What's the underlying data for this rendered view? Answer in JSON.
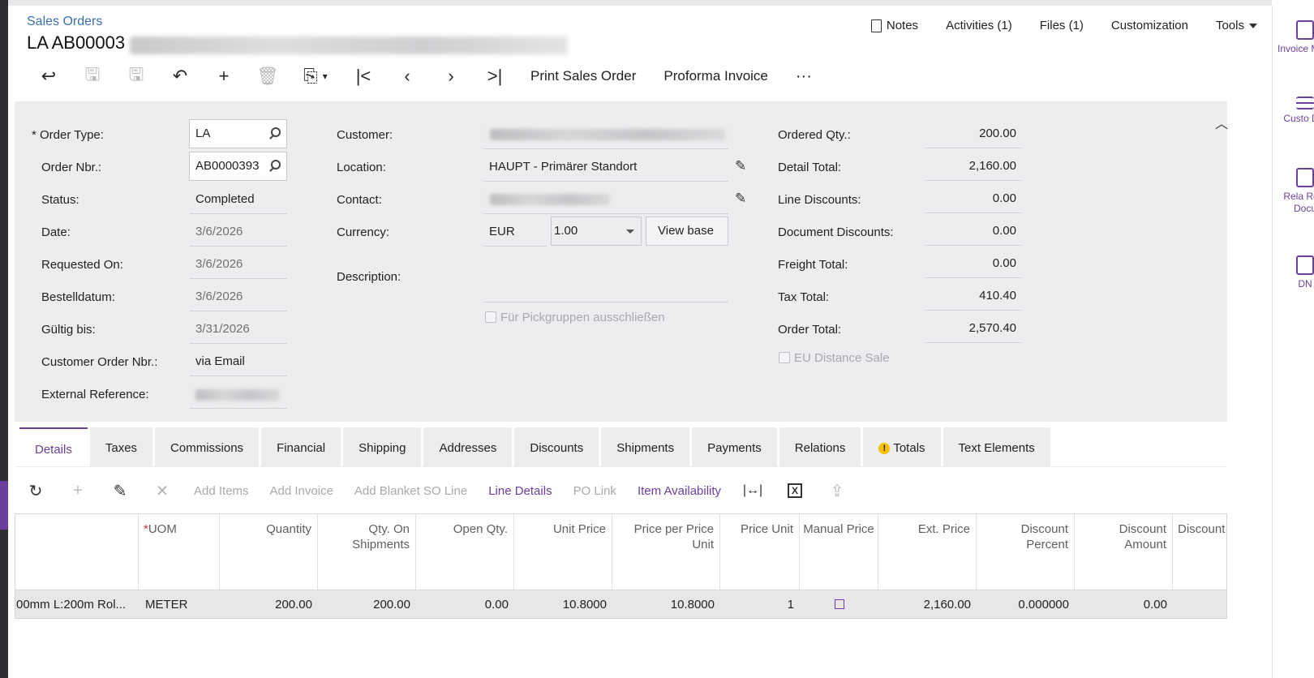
{
  "breadcrumb": "Sales Orders",
  "title": "LA AB00003",
  "top_menu": {
    "notes": "Notes",
    "activities": "Activities (1)",
    "files": "Files (1)",
    "customization": "Customization",
    "tools": "Tools"
  },
  "toolbar": {
    "print": "Print Sales Order",
    "proforma": "Proforma Invoice",
    "more": "···"
  },
  "right_panel": [
    {
      "label": "Invoice Mem",
      "icon": "invoice-icon"
    },
    {
      "label": "Custo Det",
      "icon": "list-icon"
    },
    {
      "label": "Rela Rete Docu",
      "icon": "related-docs-icon"
    },
    {
      "label": "DN",
      "icon": "dn-icon"
    }
  ],
  "form": {
    "order_type": {
      "label": "Order Type:",
      "required": "*",
      "value": "LA"
    },
    "order_nbr": {
      "label": "Order Nbr.:",
      "value": "AB0000393"
    },
    "status": {
      "label": "Status:",
      "value": "Completed"
    },
    "date": {
      "label": "Date:",
      "value": "3/6/2026"
    },
    "requested_on": {
      "label": "Requested On:",
      "value": "3/6/2026"
    },
    "bestelldatum": {
      "label": "Bestelldatum:",
      "value": "3/6/2026"
    },
    "gueltig_bis": {
      "label": "Gültig bis:",
      "value": "3/31/2026"
    },
    "customer_order_nbr": {
      "label": "Customer Order Nbr.:",
      "value": "via Email"
    },
    "external_reference": {
      "label": "External Reference:"
    },
    "customer": {
      "label": "Customer:"
    },
    "location": {
      "label": "Location:",
      "value": "HAUPT - Primärer Standort"
    },
    "contact": {
      "label": "Contact:"
    },
    "currency": {
      "label": "Currency:",
      "value": "EUR",
      "rate": "1.00",
      "view_base": "View base"
    },
    "description": {
      "label": "Description:",
      "value": ""
    },
    "pickgruppen": {
      "label": "Für Pickgruppen ausschließen",
      "checked": false
    },
    "ordered_qty": {
      "label": "Ordered Qty.:",
      "value": "200.00"
    },
    "detail_total": {
      "label": "Detail Total:",
      "value": "2,160.00"
    },
    "line_discounts": {
      "label": "Line Discounts:",
      "value": "0.00"
    },
    "document_discounts": {
      "label": "Document Discounts:",
      "value": "0.00"
    },
    "freight_total": {
      "label": "Freight Total:",
      "value": "0.00"
    },
    "tax_total": {
      "label": "Tax Total:",
      "value": "410.40"
    },
    "order_total": {
      "label": "Order Total:",
      "value": "2,570.40"
    },
    "eu_distance_sale": {
      "label": "EU Distance Sale",
      "checked": false
    }
  },
  "tabs": [
    "Details",
    "Taxes",
    "Commissions",
    "Financial",
    "Shipping",
    "Addresses",
    "Discounts",
    "Shipments",
    "Payments",
    "Relations",
    "Totals",
    "Text Elements"
  ],
  "active_tab": "Details",
  "grid_toolbar": {
    "add_items": "Add Items",
    "add_invoice": "Add Invoice",
    "add_blanket": "Add Blanket SO Line",
    "line_details": "Line Details",
    "po_link": "PO Link",
    "item_availability": "Item Availability"
  },
  "grid": {
    "columns": [
      "",
      "UOM",
      "Quantity",
      "Qty. On Shipments",
      "Open Qty.",
      "Unit Price",
      "Price per Price Unit",
      "Price Unit",
      "Manual Price",
      "Ext. Price",
      "Discount Percent",
      "Discount Amount",
      "Discount"
    ],
    "uom_required": "*",
    "rows": [
      {
        "description": "00mm L:200m Rol...",
        "uom": "METER",
        "quantity": "200.00",
        "qty_on_shipments": "200.00",
        "open_qty": "0.00",
        "unit_price": "10.8000",
        "price_per_unit": "10.8000",
        "price_unit": "1",
        "manual_price": false,
        "ext_price": "2,160.00",
        "discount_percent": "0.000000",
        "discount_amount": "0.00"
      }
    ]
  },
  "colors": {
    "accent": "#6b3fa0",
    "link": "#3a6fb0",
    "panel": "#ededef"
  }
}
